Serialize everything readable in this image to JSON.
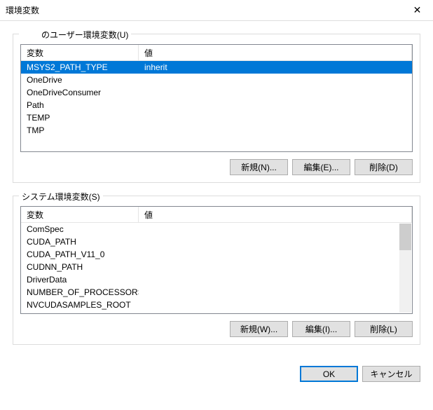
{
  "window": {
    "title": "環境変数"
  },
  "userGroup": {
    "legend": "のユーザー環境変数(U)",
    "columns": {
      "name": "変数",
      "value": "値"
    },
    "rows": [
      {
        "name": "MSYS2_PATH_TYPE",
        "value": "inherit",
        "selected": true
      },
      {
        "name": "OneDrive",
        "value": ""
      },
      {
        "name": "OneDriveConsumer",
        "value": ""
      },
      {
        "name": "Path",
        "value": ""
      },
      {
        "name": "TEMP",
        "value": ""
      },
      {
        "name": "TMP",
        "value": ""
      }
    ],
    "buttons": {
      "new": "新規(N)...",
      "edit": "編集(E)...",
      "delete": "削除(D)"
    }
  },
  "systemGroup": {
    "legend": "システム環境変数(S)",
    "columns": {
      "name": "変数",
      "value": "値"
    },
    "rows": [
      {
        "name": "ComSpec",
        "value": ""
      },
      {
        "name": "CUDA_PATH",
        "value": ""
      },
      {
        "name": "CUDA_PATH_V11_0",
        "value": ""
      },
      {
        "name": "CUDNN_PATH",
        "value": ""
      },
      {
        "name": "DriverData",
        "value": ""
      },
      {
        "name": "NUMBER_OF_PROCESSORS",
        "value": ""
      },
      {
        "name": "NVCUDASAMPLES_ROOT",
        "value": ""
      }
    ],
    "buttons": {
      "new": "新規(W)...",
      "edit": "編集(I)...",
      "delete": "削除(L)"
    }
  },
  "footer": {
    "ok": "OK",
    "cancel": "キャンセル"
  }
}
